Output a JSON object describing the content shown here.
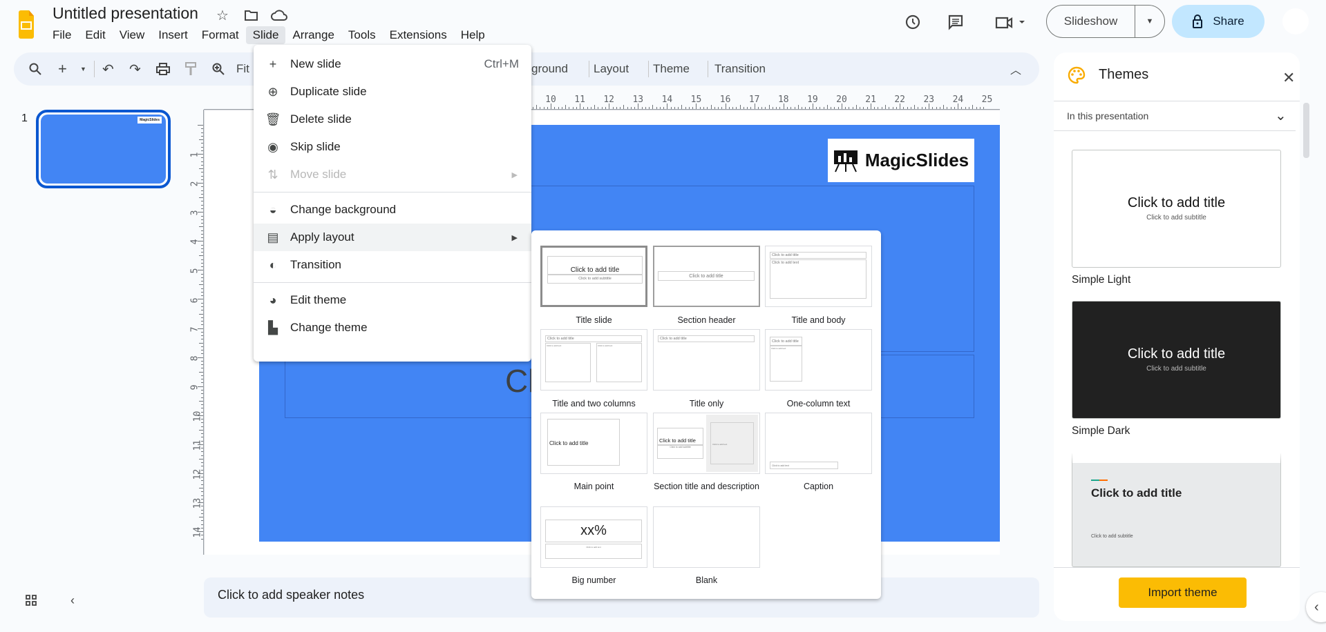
{
  "app": {
    "title": "Untitled presentation",
    "menu": [
      "File",
      "Edit",
      "View",
      "Insert",
      "Format",
      "Slide",
      "Arrange",
      "Tools",
      "Extensions",
      "Help"
    ],
    "active_menu": "Slide"
  },
  "header": {
    "slideshow_label": "Slideshow",
    "share_label": "Share"
  },
  "toolbar": {
    "fit_label": "Fit",
    "items": [
      "ground",
      "Layout",
      "Theme",
      "Transition"
    ]
  },
  "rulers": {
    "top": [
      "10",
      "11",
      "12",
      "13",
      "14",
      "15",
      "16",
      "17",
      "18",
      "19",
      "20",
      "21",
      "22",
      "23",
      "24",
      "25"
    ],
    "left": [
      "1",
      "2",
      "3",
      "4",
      "5",
      "6",
      "7",
      "8",
      "9",
      "10",
      "11",
      "12",
      "13",
      "14"
    ]
  },
  "filmstrip": {
    "slide_number": "1",
    "thumb_logo": "MagicSlides"
  },
  "slide": {
    "logo_text": "MagicSlides",
    "partial_title": "Cli",
    "background": "#4285f4"
  },
  "slide_menu": {
    "groups": [
      [
        {
          "label": "New slide",
          "icon": "plus-icon",
          "shortcut": "Ctrl+M"
        },
        {
          "label": "Duplicate slide",
          "icon": "duplicate-icon"
        },
        {
          "label": "Delete slide",
          "icon": "trash-icon"
        },
        {
          "label": "Skip slide",
          "icon": "eye-icon"
        },
        {
          "label": "Move slide",
          "icon": "move-icon",
          "disabled": true,
          "submenu": true
        }
      ],
      [
        {
          "label": "Change background",
          "icon": "background-icon"
        },
        {
          "label": "Apply layout",
          "icon": "layout-icon",
          "submenu": true,
          "highlighted": true
        },
        {
          "label": "Transition",
          "icon": "transition-icon"
        }
      ],
      [
        {
          "label": "Edit theme",
          "icon": "palette-icon"
        },
        {
          "label": "Change theme",
          "icon": "paint-roller-icon"
        }
      ]
    ]
  },
  "layouts": {
    "placeholder_title": "Click to add title",
    "placeholder_subtitle": "Click to add subtitle",
    "placeholder_text": "Click to add text",
    "big_number": "xx%",
    "items": [
      "Title slide",
      "Section header",
      "Title and body",
      "Title and two columns",
      "Title only",
      "One-column text",
      "Main point",
      "Section title and description",
      "Caption",
      "Big number",
      "Blank"
    ]
  },
  "themes_panel": {
    "title": "Themes",
    "filter": "In this presentation",
    "themes": [
      {
        "name": "Simple Light",
        "title": "Click to add title",
        "subtitle": "Click to add subtitle"
      },
      {
        "name": "Simple Dark",
        "title": "Click to add title",
        "subtitle": "Click to add subtitle"
      },
      {
        "name": "",
        "title": "Click to add title",
        "subtitle": "Click to add subtitle"
      }
    ],
    "import_label": "Import theme"
  },
  "notes": {
    "placeholder": "Click to add speaker notes"
  },
  "colors": {
    "accent": "#0b57d0",
    "share": "#c2e7ff",
    "import": "#fbbc04",
    "slide": "#4285f4"
  }
}
